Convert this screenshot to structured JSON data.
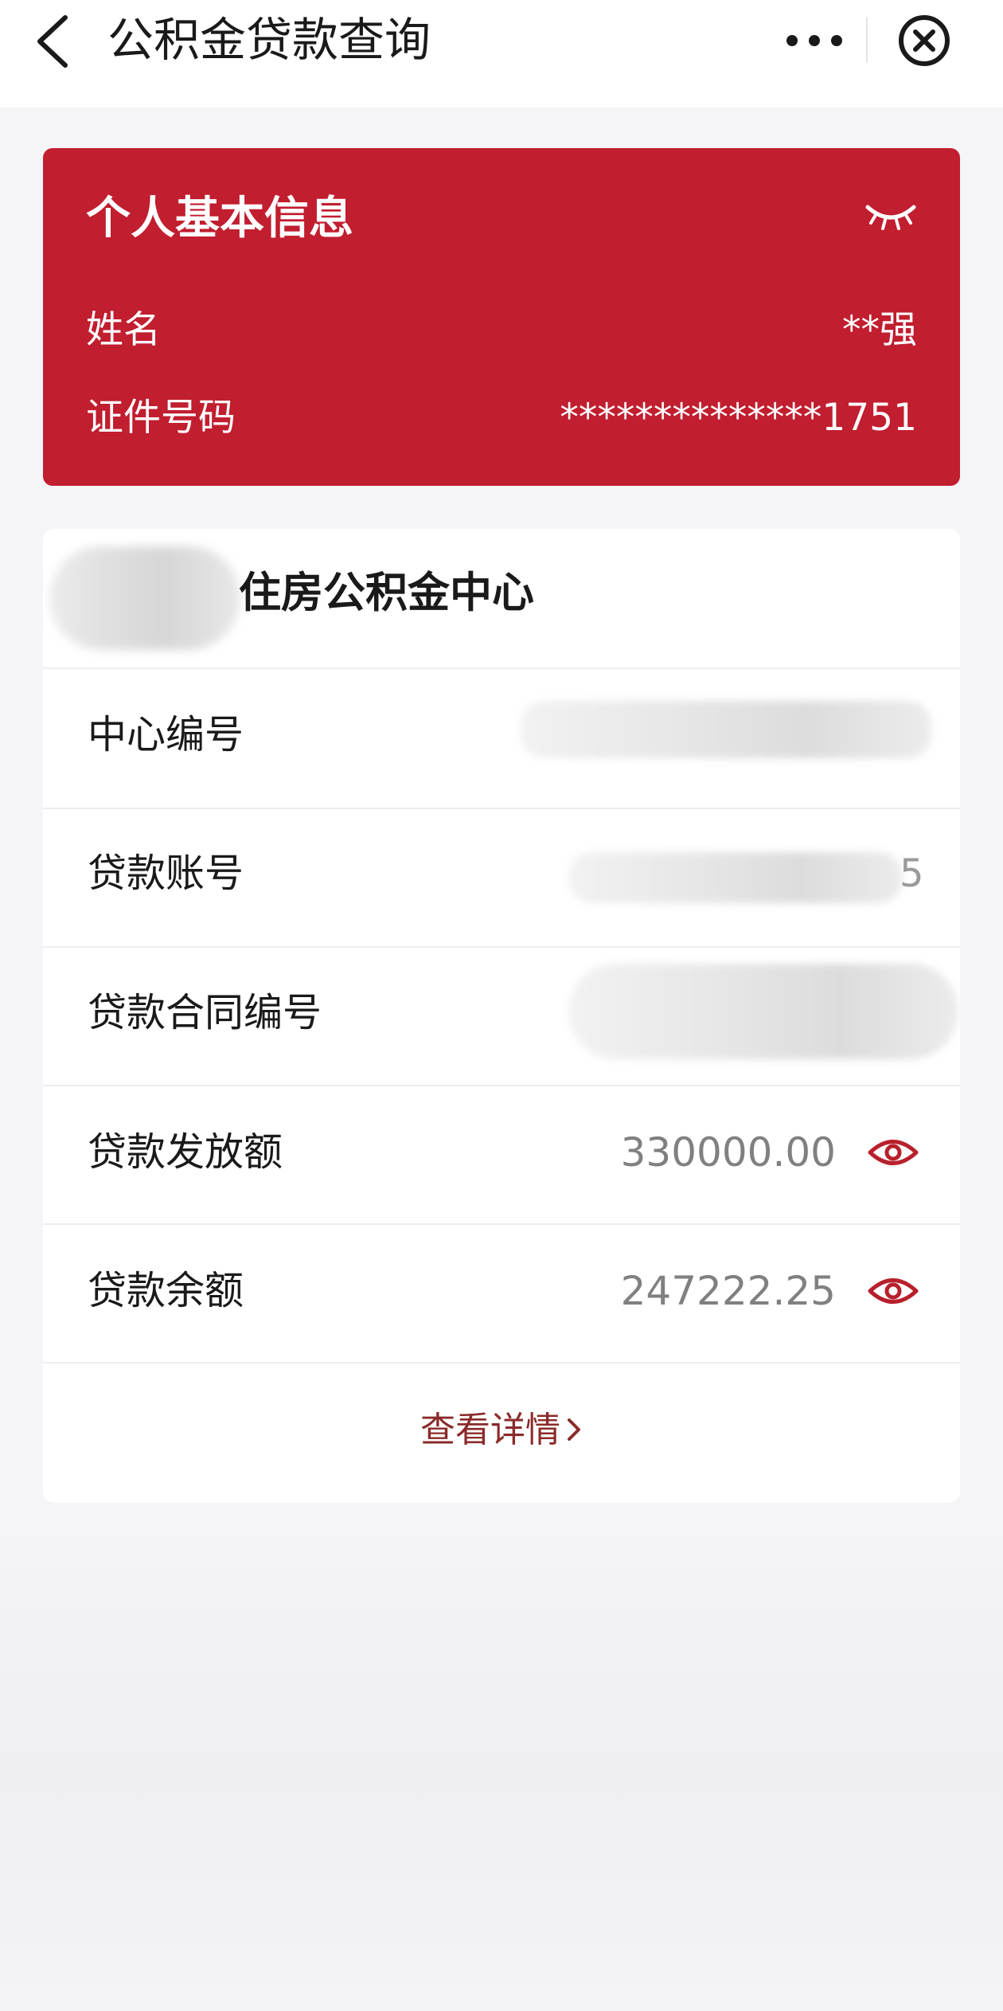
{
  "nav": {
    "title": "公积金贷款查询"
  },
  "personal_info": {
    "title": "个人基本信息",
    "name_label": "姓名",
    "name_value": "**强",
    "id_label": "证件号码",
    "id_value": "**************1751"
  },
  "loan": {
    "center_name": "住房公积金中心",
    "rows": [
      {
        "label": "中心编号"
      },
      {
        "label": "贷款账号",
        "partial_value": "5"
      },
      {
        "label": "贷款合同编号"
      },
      {
        "label": "贷款发放额",
        "value": "330000.00"
      },
      {
        "label": "贷款余额",
        "value": "247222.25"
      }
    ],
    "detail_link": "查看详情"
  },
  "colors": {
    "brand_red": "#c11e2f",
    "eye_red": "#b8202c",
    "link_red": "#8a2a2a"
  },
  "icons": [
    "back-arrow-icon",
    "more-dots-icon",
    "close-circle-icon",
    "eye-closed-icon",
    "eye-open-icon",
    "chevron-right-icon"
  ]
}
